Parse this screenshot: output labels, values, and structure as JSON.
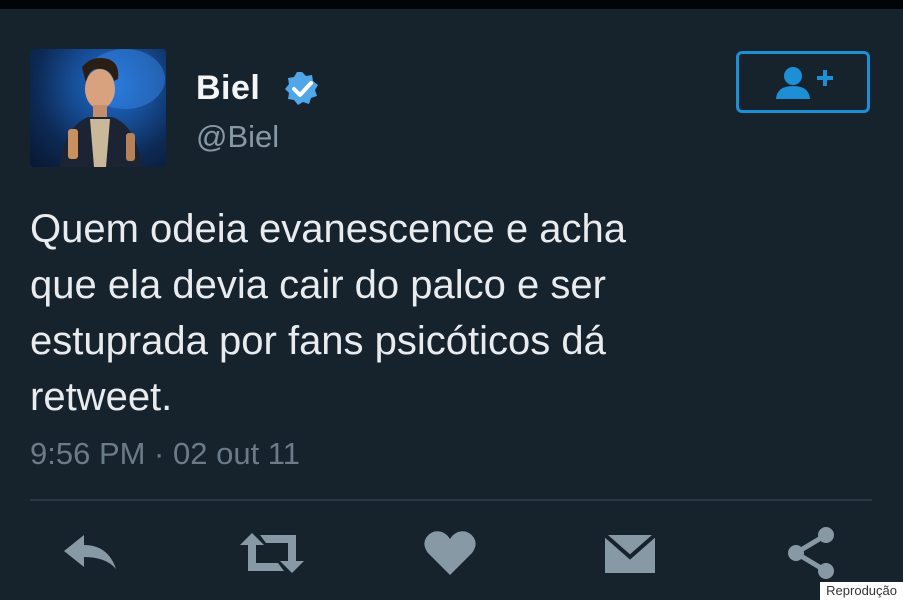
{
  "user": {
    "name": "Biel",
    "handle": "@Biel",
    "verified": true
  },
  "tweet": {
    "text": "Quem odeia evanescence e acha\nque ela devia cair do palco e ser\nestuprada por fans psicóticos dá\nretweet.",
    "timestamp": "9:56 PM · 02 out 11"
  },
  "actions": {
    "icons": [
      "reply-icon",
      "retweet-icon",
      "like-icon",
      "message-icon",
      "share-icon"
    ]
  },
  "watermark": "Reprodução",
  "colors": {
    "background": "#16222c",
    "accent": "#1d8fd5",
    "text": "#e8ecef",
    "muted": "#8899a6",
    "icon": "#8899a6"
  }
}
